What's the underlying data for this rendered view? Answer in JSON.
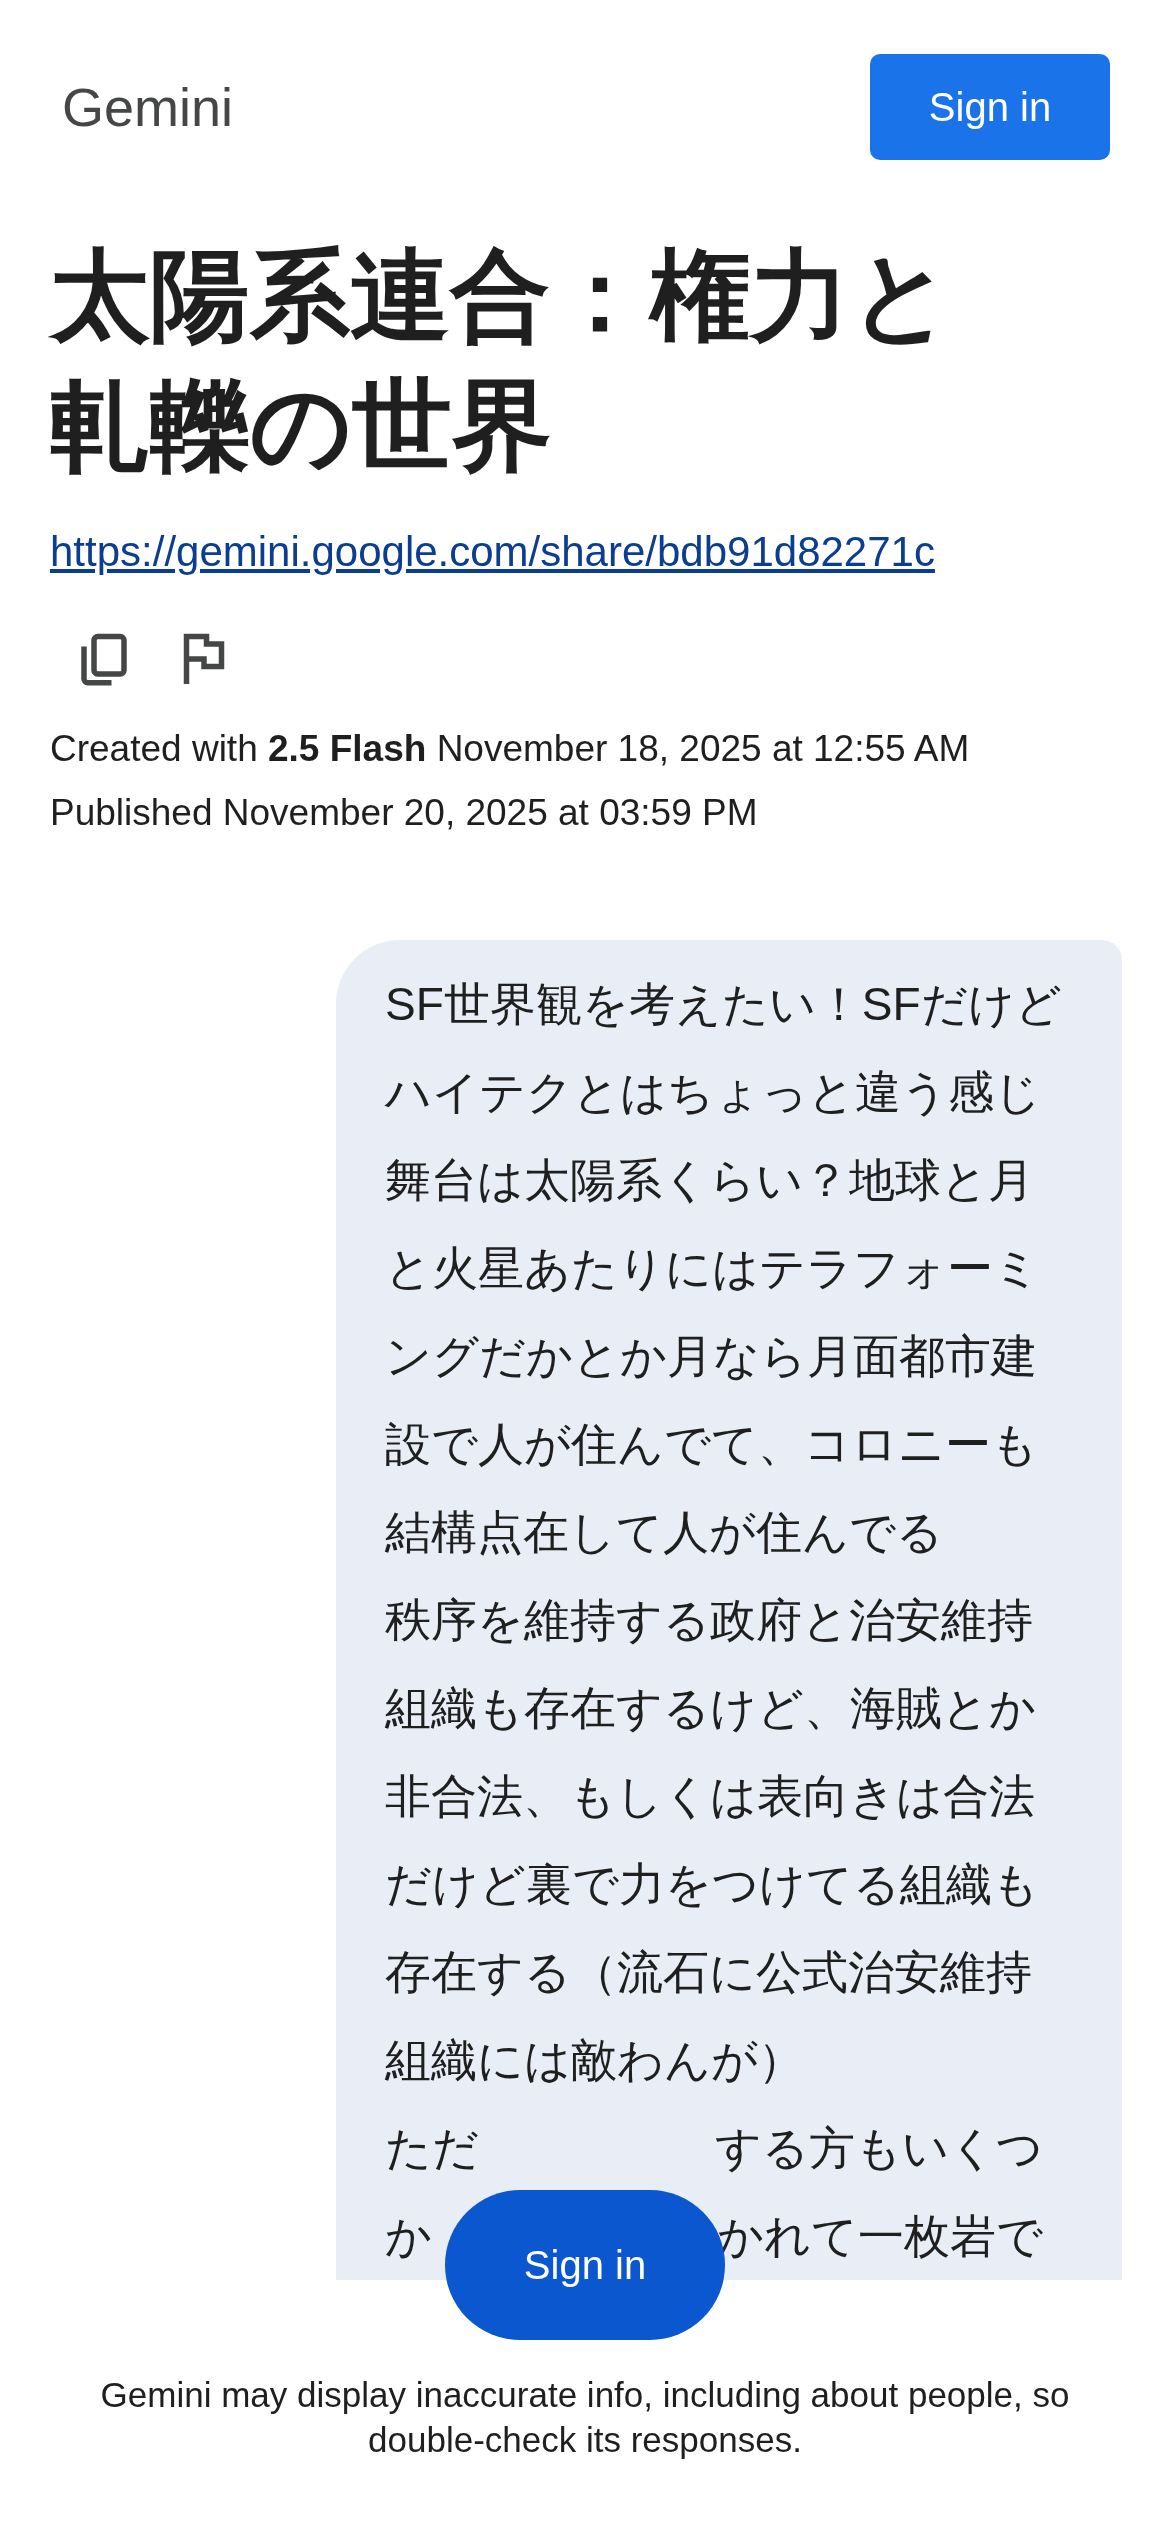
{
  "header": {
    "logo": "Gemini",
    "sign_in": "Sign in"
  },
  "title": "太陽系連合：権力と軋轢の世界",
  "link": "https://gemini.google.com/share/bdb91d82271c",
  "created": "Created with **2.5 Flash** November 18, 2025 at 12:55 AM",
  "published": "Published November 20, 2025 at 03:59 PM",
  "message": {
    "lines": [
      {
        "parts": [
          "SF世界観を考えたい！SFだけど"
        ]
      },
      {
        "parts": [
          "ハイテクとはちょっと違う感じ"
        ]
      },
      {
        "parts": [
          "舞台は太陽系くらい？地球と月"
        ]
      },
      {
        "parts": [
          "と火星あたりにはテラフォーミ"
        ]
      },
      {
        "parts": [
          "ングだかとか月なら月面都市建"
        ]
      },
      {
        "parts": [
          "設で人が住んでて、コロニーも"
        ]
      },
      {
        "parts": [
          "結構点在して人が住んでる"
        ]
      },
      {
        "parts": [
          "秩序を維持する政府と治安維持"
        ]
      },
      {
        "parts": [
          "組織も存在するけど、海賊とか"
        ]
      },
      {
        "parts": [
          "非合法、もしくは表向きは合法"
        ]
      },
      {
        "parts": [
          "だけど裏で力をつけてる組織も"
        ]
      },
      {
        "parts": [
          "存在する（流石に公式治安維持"
        ]
      },
      {
        "parts": [
          "組織には敵わんが）"
        ]
      },
      {
        "parts": [
          "ただ",
          "する方もいくつ"
        ]
      },
      {
        "parts": [
          "か",
          "かれて一枚岩で"
        ]
      }
    ]
  },
  "floating_button": "Sign in",
  "disclaimer": "Gemini may display inaccurate info, including about people, so double-check its responses."
}
